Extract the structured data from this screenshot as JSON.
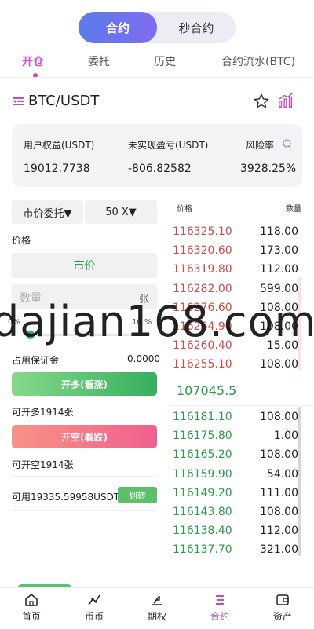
{
  "header": {
    "tab_active": "合约",
    "tab_other": "秒合约"
  },
  "subtabs": [
    "开仓",
    "委托",
    "历史",
    "合约流水(BTC)"
  ],
  "pair": "BTC/USDT",
  "summary": {
    "equity_label": "用户权益(USDT)",
    "equity_value": "19012.7738",
    "pnl_label": "未实现盈亏(USDT)",
    "pnl_value": "-806.82582",
    "risk_label": "风险率",
    "risk_value": "3928.25%"
  },
  "order_form": {
    "order_type": "市价委托▼",
    "leverage": "50 X▼",
    "price_label": "价格",
    "price_value": "市价",
    "qty_placeholder": "数量",
    "qty_unit": "张",
    "slider_min": "0%",
    "slider_mark": "10 %",
    "margin_label": "占用保证金",
    "margin_value": "0.0000",
    "buy_label": "开多(看涨)",
    "can_buy": "可开多1914张",
    "sell_label": "开空(看跌)",
    "can_sell": "可开空1914张",
    "available": "可用19335.59958USDT",
    "transfer": "划转"
  },
  "orderbook": {
    "price_header": "价格",
    "qty_header": "数量",
    "asks": [
      {
        "price": "116325.10",
        "qty": "118.00"
      },
      {
        "price": "116320.60",
        "qty": "173.00"
      },
      {
        "price": "116319.80",
        "qty": "112.00"
      },
      {
        "price": "116282.00",
        "qty": "599.00"
      },
      {
        "price": "116276.60",
        "qty": "108.00"
      },
      {
        "price": "116264.90",
        "qty": "108.00"
      },
      {
        "price": "116260.40",
        "qty": "15.00"
      },
      {
        "price": "116255.10",
        "qty": "108.00"
      }
    ],
    "last_price": "107045.5",
    "bids": [
      {
        "price": "116181.10",
        "qty": "108.00"
      },
      {
        "price": "116175.80",
        "qty": "1.00"
      },
      {
        "price": "116165.20",
        "qty": "108.00"
      },
      {
        "price": "116159.90",
        "qty": "54.00"
      },
      {
        "price": "116149.20",
        "qty": "111.00"
      },
      {
        "price": "116143.80",
        "qty": "108.00"
      },
      {
        "price": "116138.40",
        "qty": "112.00"
      },
      {
        "price": "116137.70",
        "qty": "321.00"
      }
    ]
  },
  "watermark": "dajian168.com",
  "nav": [
    "首页",
    "币币",
    "期权",
    "合约",
    "资产"
  ]
}
